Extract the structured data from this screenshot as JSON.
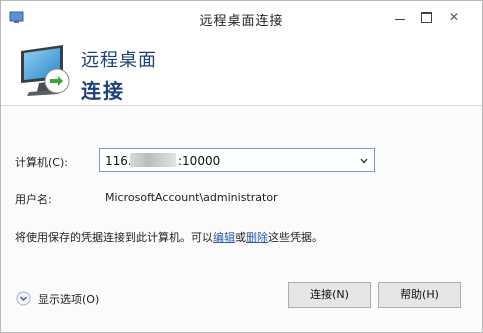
{
  "window": {
    "title": "远程桌面连接",
    "controls": {
      "minimize": "minimize-icon",
      "maximize": "maximize-icon",
      "close": "close-icon",
      "close_glyph": "✕"
    }
  },
  "header": {
    "line1": "远程桌面",
    "line2": "连接"
  },
  "form": {
    "computer_label": "计算机(C):",
    "computer_value_prefix": "116.",
    "computer_value_suffix": ":10000",
    "user_label": "用户名:",
    "user_value": "MicrosoftAccount\\administrator",
    "notice_before": "将使用保存的凭据连接到此计算机。可以",
    "notice_edit": "编辑",
    "notice_or": "或",
    "notice_delete": "删除",
    "notice_after": "这些凭据。"
  },
  "footer": {
    "options_label": "显示选项(O)",
    "connect_label": "连接(N)",
    "help_label": "帮助(H)"
  },
  "colors": {
    "header_text": "#1f3f7a",
    "link": "#2a5db0",
    "combo_border": "#7a9bd1"
  }
}
